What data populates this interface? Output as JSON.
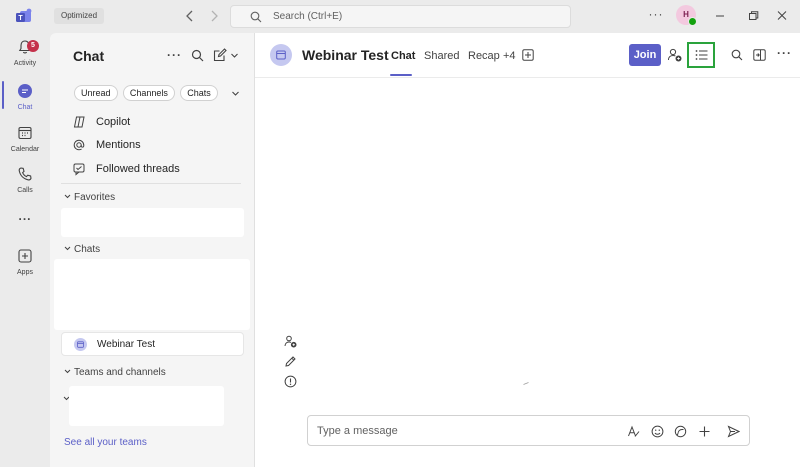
{
  "titlebar": {
    "mode_badge": "Optimized",
    "search_placeholder": "Search (Ctrl+E)",
    "avatar_initial": "H"
  },
  "rail": {
    "items": [
      {
        "label": "Activity",
        "icon": "bell-icon",
        "badge": "5"
      },
      {
        "label": "Chat",
        "icon": "chat-icon"
      },
      {
        "label": "Calendar",
        "icon": "calendar-icon"
      },
      {
        "label": "Calls",
        "icon": "phone-icon"
      },
      {
        "label": "Apps",
        "icon": "add-app-icon"
      }
    ],
    "more_label": "..."
  },
  "chat_list": {
    "title": "Chat",
    "filters": [
      "Unread",
      "Channels",
      "Chats"
    ],
    "quick_links": [
      {
        "label": "Copilot",
        "icon": "copilot-icon"
      },
      {
        "label": "Mentions",
        "icon": "at-icon"
      },
      {
        "label": "Followed threads",
        "icon": "followed-threads-icon"
      }
    ],
    "sections": {
      "favorites": "Favorites",
      "chats": "Chats",
      "teams": "Teams and channels"
    },
    "selected_chat": "Webinar Test",
    "see_all_teams": "See all your teams"
  },
  "main": {
    "title": "Webinar Test",
    "tabs": [
      "Chat",
      "Shared",
      "Recap",
      "+4"
    ],
    "active_tab": "Chat",
    "join_label": "Join",
    "compose_placeholder": "Type a message"
  },
  "colors": {
    "brand": "#5b5fc7",
    "highlight_box": "#2aa33c",
    "badge": "#c4314b",
    "presence": "#13a10e"
  }
}
